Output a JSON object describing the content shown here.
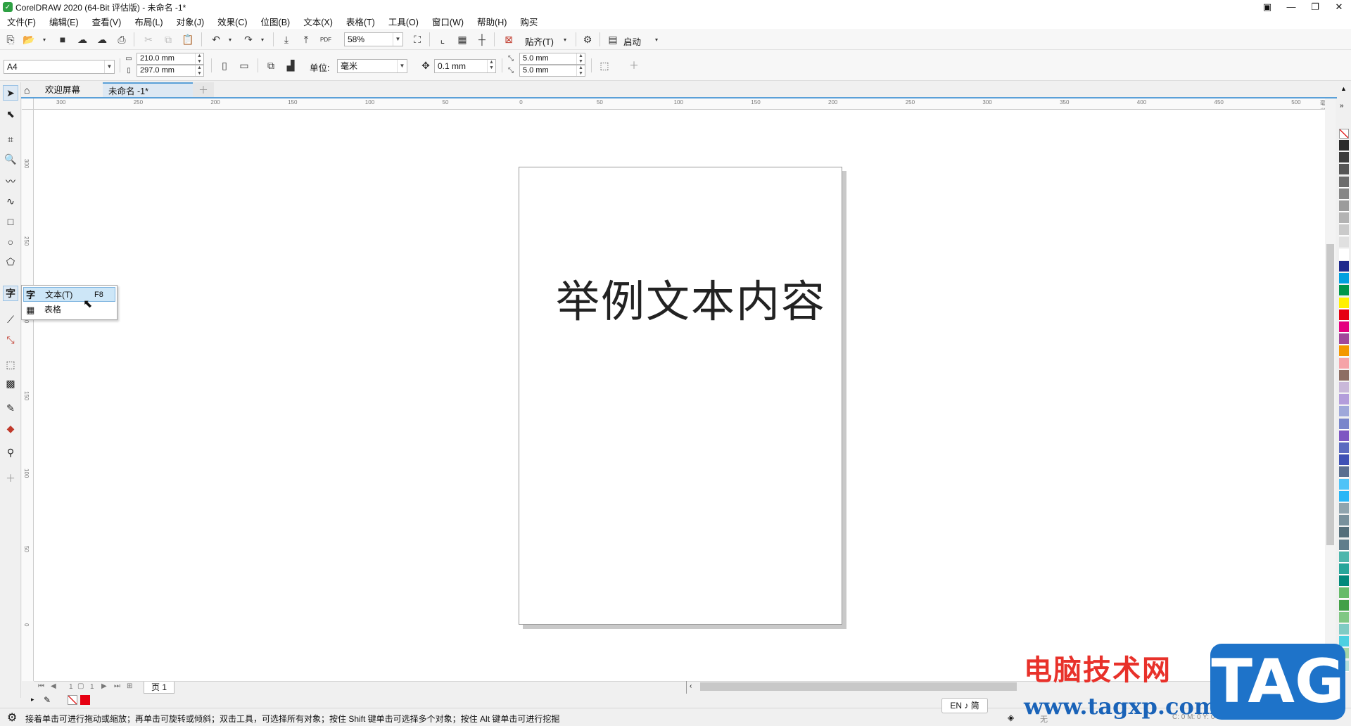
{
  "window": {
    "title": "CorelDRAW 2020 (64-Bit 评估版) - 未命名 -1*",
    "app_icon": "coreldraw-logo-icon"
  },
  "menu": [
    "文件(F)",
    "编辑(E)",
    "查看(V)",
    "布局(L)",
    "对象(J)",
    "效果(C)",
    "位图(B)",
    "文本(X)",
    "表格(T)",
    "工具(O)",
    "窗口(W)",
    "帮助(H)",
    "购买"
  ],
  "toolbar": {
    "zoom": "58%",
    "snap_label": "贴齐(T)",
    "launch_label": "启动",
    "pdf_label": "PDF"
  },
  "property_bar": {
    "page_size": "A4",
    "width": "210.0 mm",
    "height": "297.0 mm",
    "unit_label": "单位:",
    "unit_value": "毫米",
    "nudge": "0.1 mm",
    "dup_x": "5.0 mm",
    "dup_y": "5.0 mm"
  },
  "tabs": {
    "welcome": "欢迎屏幕",
    "document": "未命名 -1*"
  },
  "ruler_h": [
    "300",
    "250",
    "200",
    "150",
    "100",
    "50",
    "0",
    "50",
    "100",
    "150",
    "200",
    "250",
    "300",
    "350",
    "400",
    "450",
    "500"
  ],
  "ruler_h_unit": "毫米",
  "ruler_v": [
    "300",
    "250",
    "200",
    "150",
    "100",
    "50",
    "0"
  ],
  "canvas": {
    "text": "举例文本内容"
  },
  "flyout": {
    "items": [
      {
        "icon": "字",
        "label": "文本(T)",
        "shortcut": "F8"
      },
      {
        "icon": "table-icon",
        "label": "表格",
        "shortcut": ""
      }
    ]
  },
  "text_tool_glyph": "字",
  "pagebar": {
    "page_count": "1",
    "page_total": "1",
    "page_tab": "页 1"
  },
  "status": {
    "hint": "接着单击可进行拖动或缩放；再单击可旋转或倾斜；双击工具，可选择所有对象；按住 Shift 键单击可选择多个对象；按住 Alt 键单击可进行挖掘",
    "ime": "EN ♪ 简",
    "fill_none": "无",
    "cmyk": "C: 0 M: 0 Y: 0 K: 100"
  },
  "watermark": {
    "cn": "电脑技术网",
    "url": "www.tagxp.com",
    "tag": "TAG"
  },
  "palette_colors": [
    "#2b2b2b",
    "#3c3c3c",
    "#555555",
    "#6d6d6d",
    "#878787",
    "#9c9c9c",
    "#b3b3b3",
    "#cacaca",
    "#e0e0e0",
    "#ffffff",
    "#1f2a8c",
    "#00a0e0",
    "#00964b",
    "#fff000",
    "#e60012",
    "#e4007f",
    "#a0479a",
    "#f39800",
    "#f5a3a8",
    "#8d6e63",
    "#c9b8d9",
    "#b39ddb",
    "#9fa8da",
    "#7986cb",
    "#7e57c2",
    "#5c6bc0",
    "#3f51b5",
    "#5b6f90",
    "#4fc3f7",
    "#29b6f6",
    "#90a4ae",
    "#78909c",
    "#546e7a",
    "#607d8b",
    "#4db6ac",
    "#26a69a",
    "#00897b",
    "#66bb6a",
    "#43a047",
    "#81c784",
    "#80cbc4",
    "#4dd0e1",
    "#a5d6a7",
    "#b2dfdb"
  ]
}
